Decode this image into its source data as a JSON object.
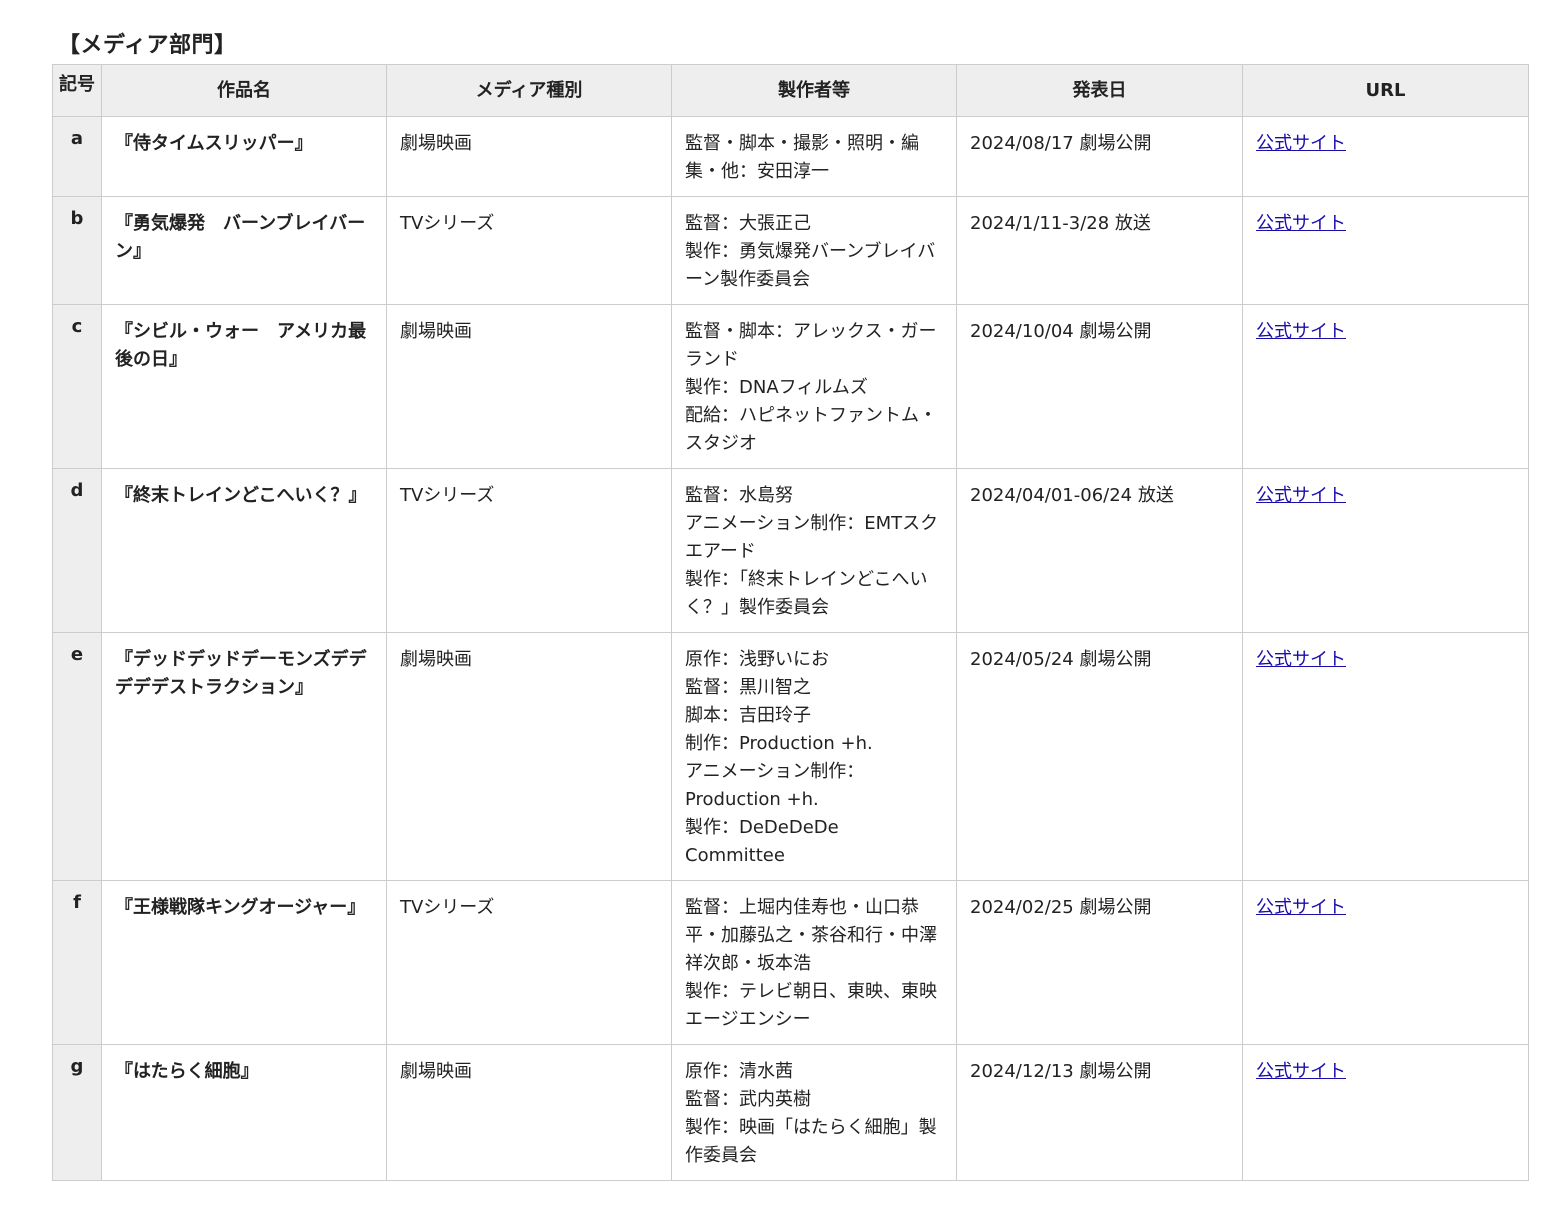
{
  "section_title": "【メディア部門】",
  "headers": {
    "code": "記号",
    "title": "作品名",
    "media": "メディア種別",
    "maker": "製作者等",
    "date": "発表日",
    "url": "URL"
  },
  "rows": [
    {
      "code": "a",
      "title": "『侍タイムスリッパー』",
      "media": "劇場映画",
      "maker": [
        "監督・脚本・撮影・照明・編集・他：安田淳一"
      ],
      "date": "2024/08/17 劇場公開",
      "link": "公式サイト"
    },
    {
      "code": "b",
      "title": "『勇気爆発　バーンブレイバーン』",
      "media": "TVシリーズ",
      "maker": [
        "監督：大張正己",
        "製作：勇気爆発バーンブレイバーン製作委員会"
      ],
      "date": "2024/1/11-3/28 放送",
      "link": "公式サイト"
    },
    {
      "code": "c",
      "title": "『シビル・ウォー　アメリカ最後の日』",
      "media": "劇場映画",
      "maker": [
        "監督・脚本：アレックス・ガーランド",
        "製作：DNAフィルムズ",
        "配給：ハピネットファントム・スタジオ"
      ],
      "date": "2024/10/04 劇場公開",
      "link": "公式サイト"
    },
    {
      "code": "d",
      "title": "『終末トレインどこへいく？』",
      "media": "TVシリーズ",
      "maker": [
        "監督：水島努",
        "アニメーション制作：EMTスクエアード",
        "製作：「終末トレインどこへいく？」製作委員会"
      ],
      "date": "2024/04/01-06/24 放送",
      "link": "公式サイト"
    },
    {
      "code": "e",
      "title": "『デッドデッドデーモンズデデデデデストラクション』",
      "media": "劇場映画",
      "maker": [
        "原作：浅野いにお",
        "監督：黒川智之",
        "脚本：吉田玲子",
        "制作：Production +h.",
        "アニメーション制作：Production +h.",
        "製作：DeDeDeDe Committee"
      ],
      "date": "2024/05/24 劇場公開",
      "link": "公式サイト"
    },
    {
      "code": "f",
      "title": "『王様戦隊キングオージャー』",
      "media": "TVシリーズ",
      "maker": [
        "監督：上堀内佳寿也・山口恭平・加藤弘之・茶谷和行・中澤祥次郎・坂本浩",
        "製作：テレビ朝日、東映、東映エージエンシー"
      ],
      "date": "2024/02/25 劇場公開",
      "link": "公式サイト"
    },
    {
      "code": "g",
      "title": "『はたらく細胞』",
      "media": "劇場映画",
      "maker": [
        "原作：清水茜",
        "監督：武内英樹",
        "製作：映画「はたらく細胞」製作委員会"
      ],
      "date": "2024/12/13 劇場公開",
      "link": "公式サイト"
    }
  ]
}
